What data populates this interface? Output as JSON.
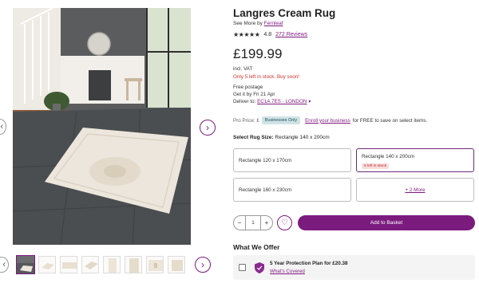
{
  "product": {
    "title": "Langres Cream Rug",
    "see_more_prefix": "See More by",
    "brand": "Fernleaf",
    "stars": "★★★★★",
    "rating": "4.8",
    "reviews": "272 Reviews",
    "price": "£199.99",
    "vat_note": "incl. VAT",
    "stock_note": "Only 5 left in stock. Buy soon!",
    "postage": "Free postage",
    "delivery": "Get it by Fri 21 Apr",
    "deliver_to_prefix": "Deliver to:",
    "deliver_to_location": "EC1A 7ES - LONDON",
    "pro_price_prefix": "Pro Price: £",
    "businesses_badge": "Businesses Only",
    "enroll_link": "Enroll your business",
    "enroll_suffix": "for FREE to save on select items."
  },
  "size": {
    "label_bold": "Select Rug Size:",
    "label_value": "Rectangle 140 x 200cm",
    "options": [
      {
        "label": "Rectangle 120 x 170cm"
      },
      {
        "label": "Rectangle 140 x 200cm",
        "badge": "5 left in stock",
        "selected": true
      },
      {
        "label": "Rectangle 160 x 230cm"
      }
    ],
    "more": "+ 2 More"
  },
  "purchase": {
    "minus": "−",
    "quantity": "1",
    "plus": "+",
    "heart": "♡",
    "add_to_basket": "Add to Basket"
  },
  "offer": {
    "title": "What We Offer",
    "plan": "5 Year Protection Plan for £20.38",
    "link": "What's Covered"
  },
  "gallery": {
    "next": "›",
    "prev": "‹",
    "thumb_count": 8
  },
  "colors": {
    "accent": "#7f187f",
    "stock_red": "#d3302a",
    "badge_teal": "#cfe3e5"
  }
}
